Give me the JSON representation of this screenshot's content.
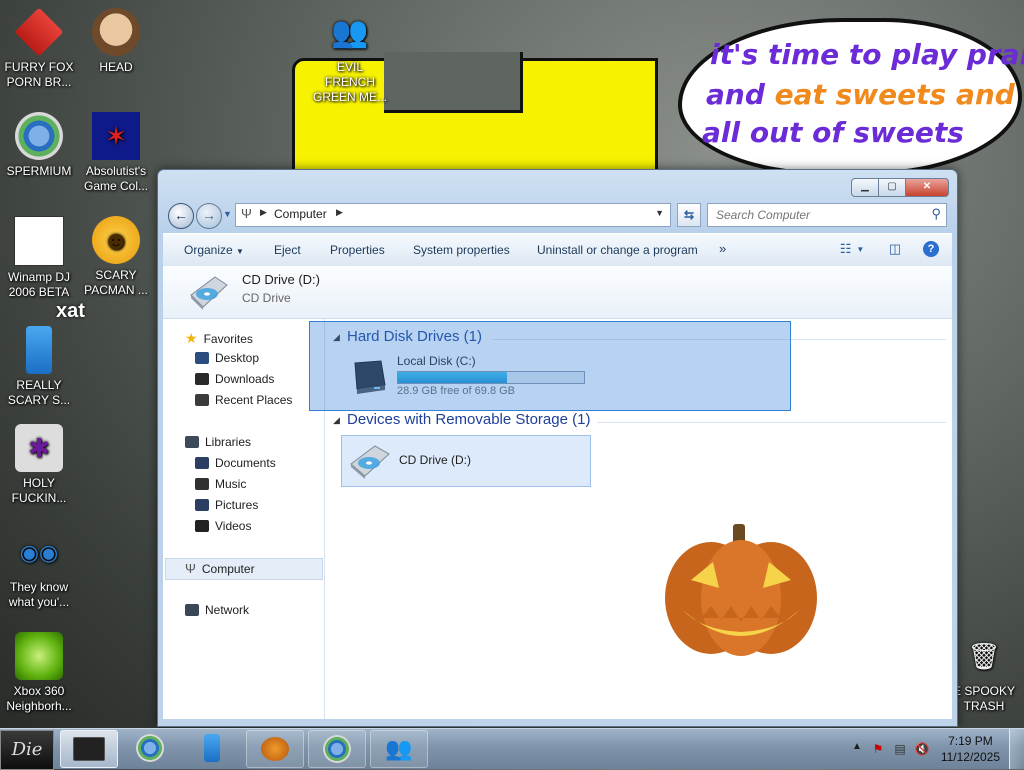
{
  "desktop": {
    "speech_bubble": {
      "line1": "it's time to play pranks",
      "line2a": "and ",
      "line2b": "eat sweets and im",
      "line3": "all out of sweets"
    },
    "icons": [
      {
        "label": "FURRY FOX PORN BR..."
      },
      {
        "label": "HEAD"
      },
      {
        "label": "EVIL FRENCH GREEN ME..."
      },
      {
        "label": "SPERMIUM"
      },
      {
        "label": "Absolutist's Game Col..."
      },
      {
        "label": "Winamp DJ 2006 BETA"
      },
      {
        "label": "SCARY PACMAN ..."
      },
      {
        "label": "REALLY SCARY S..."
      },
      {
        "label": "HOLY FUCKIN..."
      },
      {
        "label": "They know what you'..."
      },
      {
        "label": "Xbox 360 Neighborh..."
      },
      {
        "label": "E SPOOKY TRASH"
      }
    ],
    "xat_text": "xat"
  },
  "window": {
    "address": {
      "crumb": "Computer"
    },
    "search": {
      "placeholder": "Search Computer"
    },
    "commands": {
      "organize": "Organize",
      "eject": "Eject",
      "properties": "Properties",
      "system_properties": "System properties",
      "uninstall": "Uninstall or change a program",
      "more": "»"
    },
    "details": {
      "title": "CD Drive (D:)",
      "subtitle": "CD Drive"
    },
    "nav": {
      "favorites": "Favorites",
      "desktop": "Desktop",
      "downloads": "Downloads",
      "recent": "Recent Places",
      "libraries": "Libraries",
      "documents": "Documents",
      "music": "Music",
      "pictures": "Pictures",
      "videos": "Videos",
      "computer": "Computer",
      "network": "Network"
    },
    "groups": {
      "hdd": "Hard Disk Drives (1)",
      "removable": "Devices with Removable Storage (1)"
    },
    "local_disk": {
      "name": "Local Disk (C:)",
      "free": "28.9 GB free of 69.8 GB",
      "used_fraction": 0.586
    },
    "cd_drive": {
      "name": "CD Drive (D:)"
    }
  },
  "taskbar": {
    "start_label": "Die",
    "clock_time": "7:19 PM",
    "clock_date": "11/12/2025"
  },
  "colors": {
    "accent_blue": "#1e3f9a",
    "progress_fill": "#1e9ad4",
    "selection": "#3380d7"
  }
}
